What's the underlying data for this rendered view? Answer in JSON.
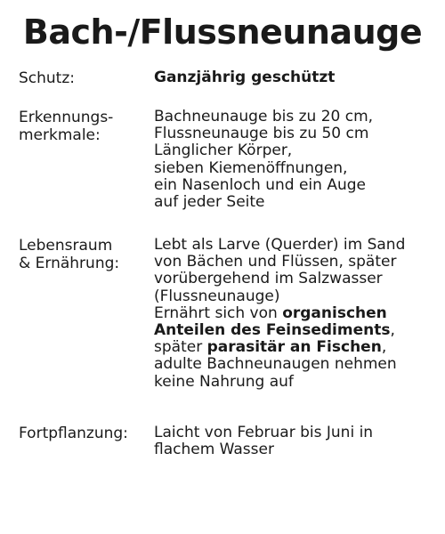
{
  "title": "Bach-/Flussneunauge",
  "rows": {
    "schutz": {
      "label": "Schutz:",
      "value": "Ganzjährig geschützt"
    },
    "erkennung": {
      "label": "Erkennungs-\nmerkmale:",
      "lines": [
        "Bachneunauge bis zu 20 cm,",
        "Flussneunauge bis zu 50 cm",
        "Länglicher Körper,",
        "sieben Kiemenöffnungen,",
        "ein Nasenloch und ein Auge",
        "auf jeder Seite"
      ]
    },
    "lebensraum": {
      "label": "Lebensraum\n& Ernährung:",
      "line1": "Lebt als Larve (Querder) im Sand",
      "line2": "von Bächen und Flüssen, später",
      "line3": "vorübergehend im Salzwasser",
      "line4": "(Flussneunauge)",
      "line5_plain": "Ernährt sich von ",
      "line5_bold": "organischen",
      "line6_bold": "Anteilen des Feinsediments",
      "line6_plain": ",",
      "line7_plain": "später ",
      "line7_bold": "parasitär an Fischen",
      "line7_end": ",",
      "line8": "adulte Bachneunaugen nehmen",
      "line9": "keine Nahrung auf"
    },
    "fortpflanzung": {
      "label": "Fortpflanzung:",
      "lines": [
        "Laicht von Februar bis Juni in",
        "flachem Wasser"
      ]
    }
  }
}
